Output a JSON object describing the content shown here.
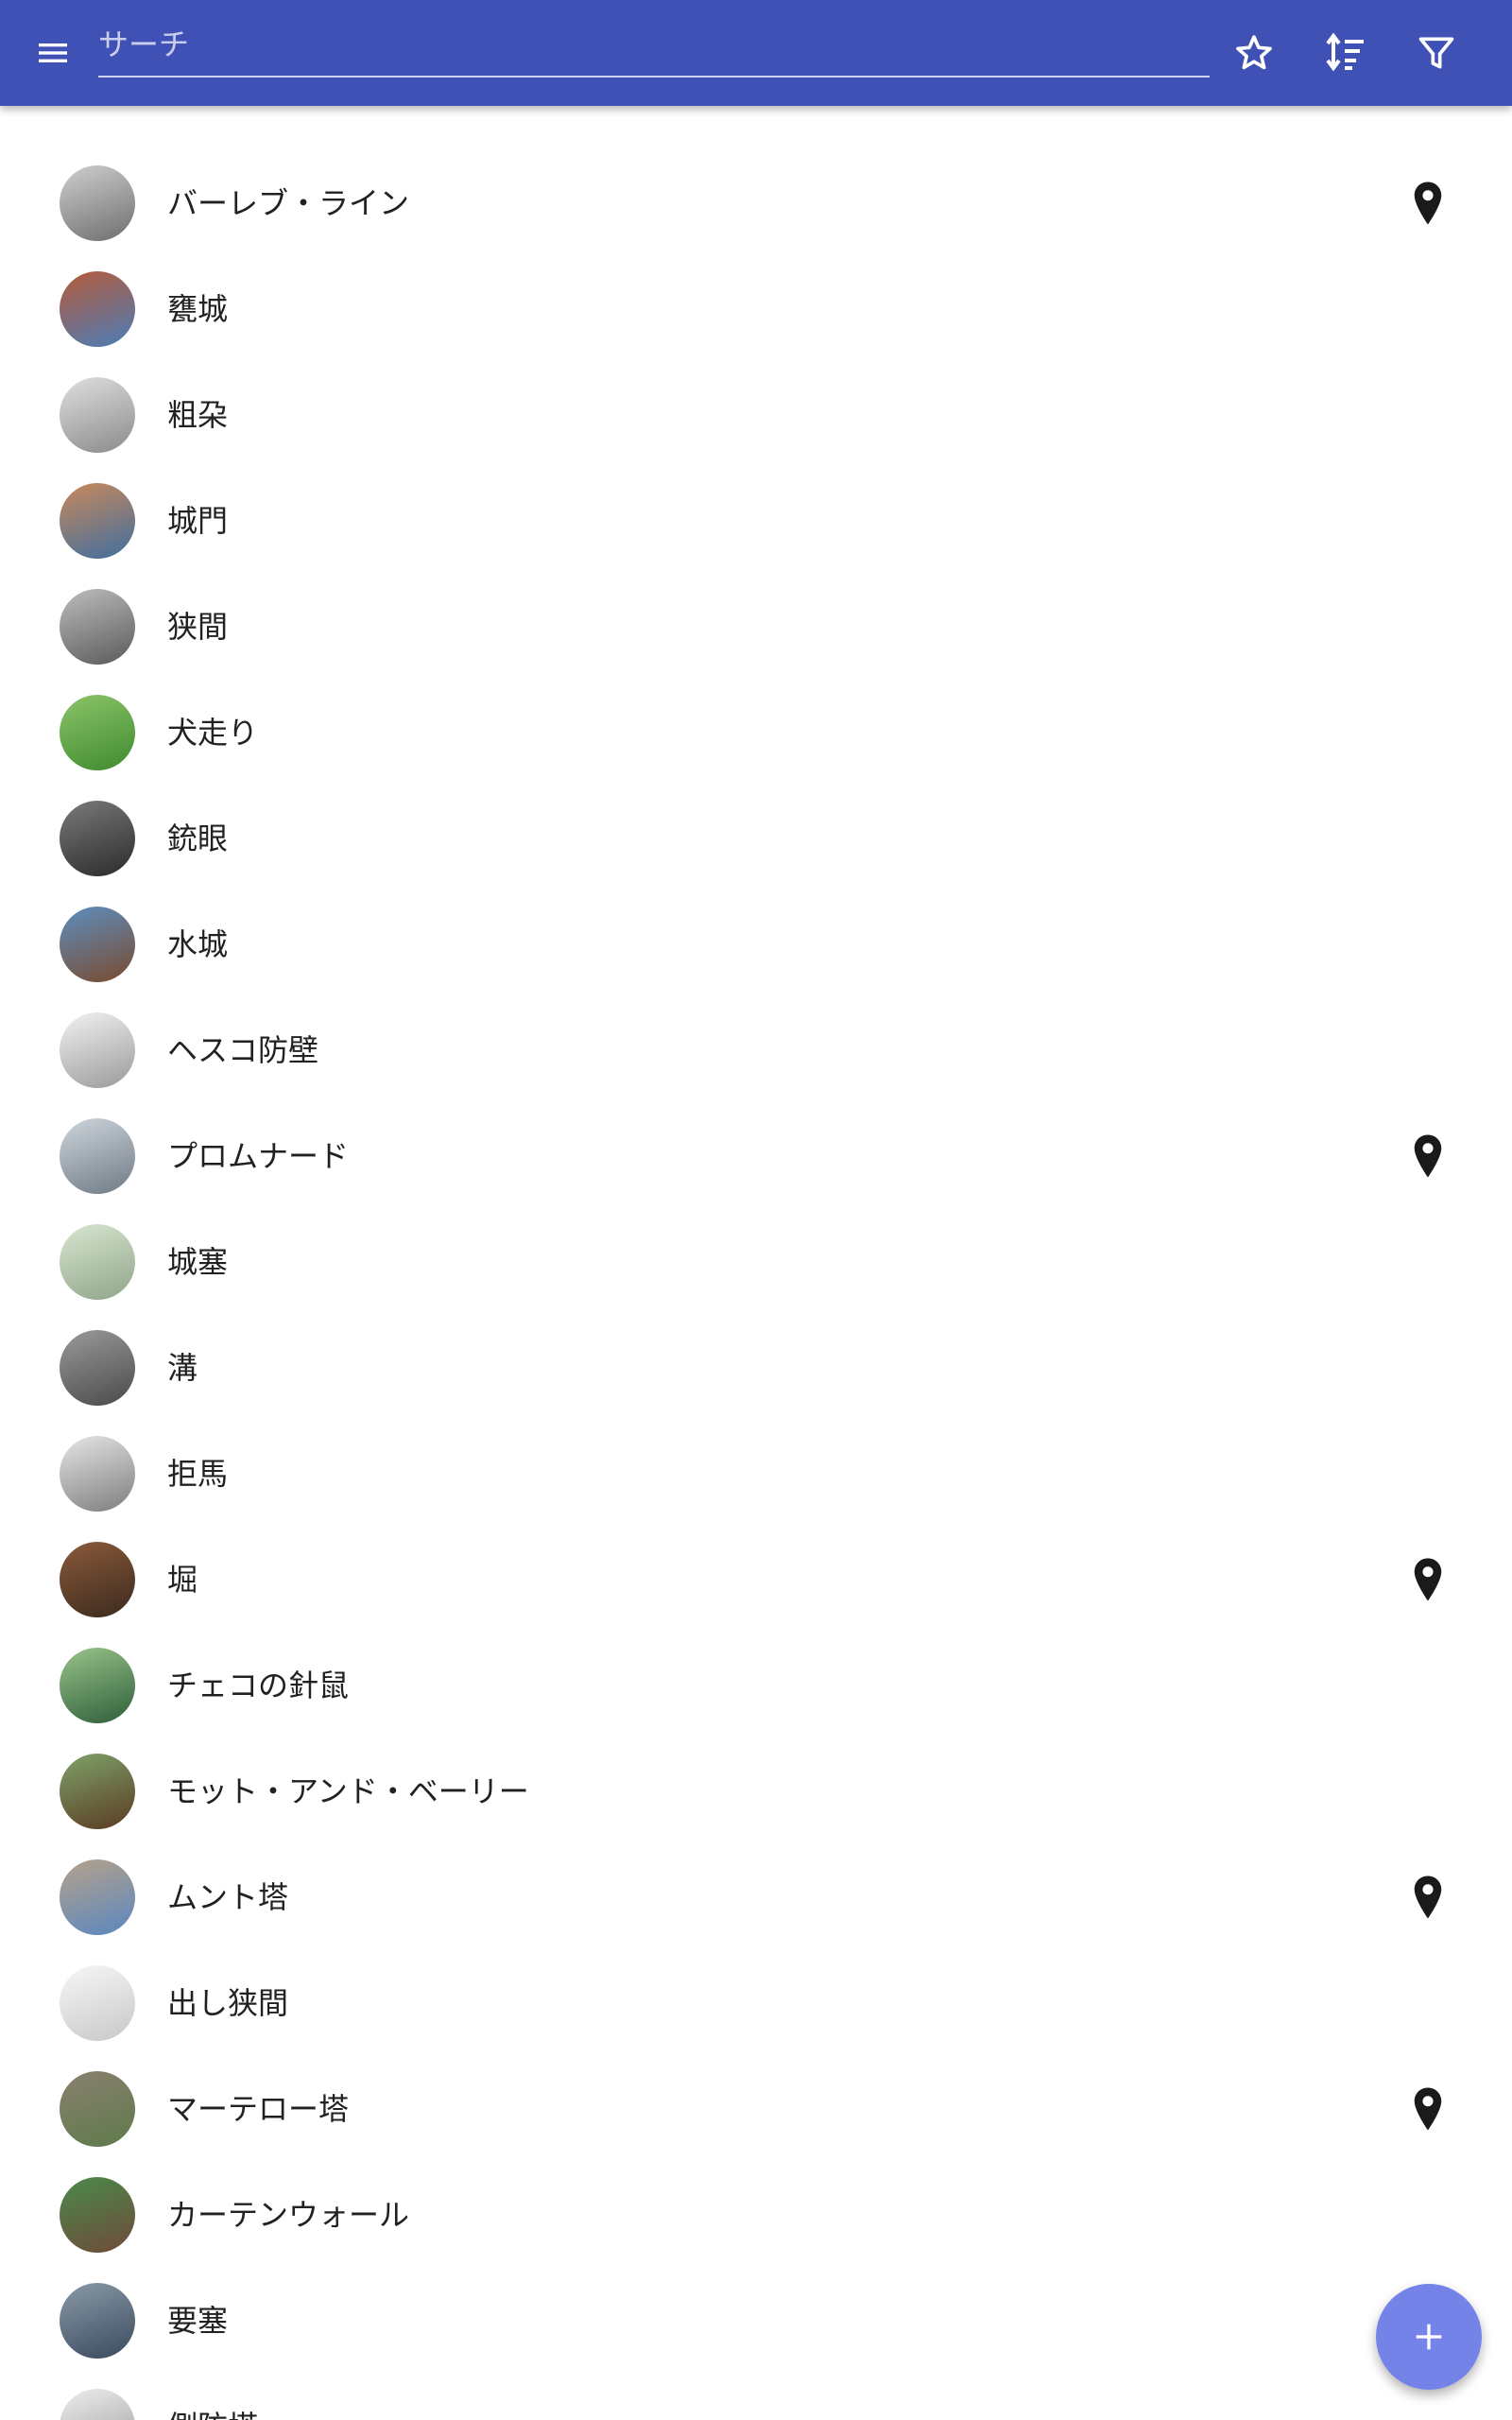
{
  "search": {
    "placeholder": "サーチ"
  },
  "colors": {
    "appbar": "#3f51b5",
    "fab": "#7483e8",
    "text": "#212121",
    "pin": "#1a1a1a"
  },
  "toolbar": {
    "menu_icon": "menu-icon",
    "favorite_icon": "star-outline-icon",
    "sort_icon": "sort-icon",
    "filter_icon": "filter-icon"
  },
  "items": [
    {
      "label": "バーレブ・ライン",
      "has_location": true
    },
    {
      "label": "甕城",
      "has_location": false
    },
    {
      "label": "粗朶",
      "has_location": false
    },
    {
      "label": "城門",
      "has_location": false
    },
    {
      "label": "狭間",
      "has_location": false
    },
    {
      "label": "犬走り",
      "has_location": false
    },
    {
      "label": "銃眼",
      "has_location": false
    },
    {
      "label": "水城",
      "has_location": false
    },
    {
      "label": "ヘスコ防壁",
      "has_location": false
    },
    {
      "label": "プロムナード",
      "has_location": true
    },
    {
      "label": "城塞",
      "has_location": false
    },
    {
      "label": "溝",
      "has_location": false
    },
    {
      "label": "拒馬",
      "has_location": false
    },
    {
      "label": "堀",
      "has_location": true
    },
    {
      "label": "チェコの針鼠",
      "has_location": false
    },
    {
      "label": "モット・アンド・ベーリー",
      "has_location": false
    },
    {
      "label": "ムント塔",
      "has_location": true
    },
    {
      "label": "出し狭間",
      "has_location": false
    },
    {
      "label": "マーテロー塔",
      "has_location": true
    },
    {
      "label": "カーテンウォール",
      "has_location": false
    },
    {
      "label": "要塞",
      "has_location": false
    },
    {
      "label": "側防塔",
      "has_location": false
    }
  ],
  "fab": {
    "icon": "plus-icon"
  }
}
